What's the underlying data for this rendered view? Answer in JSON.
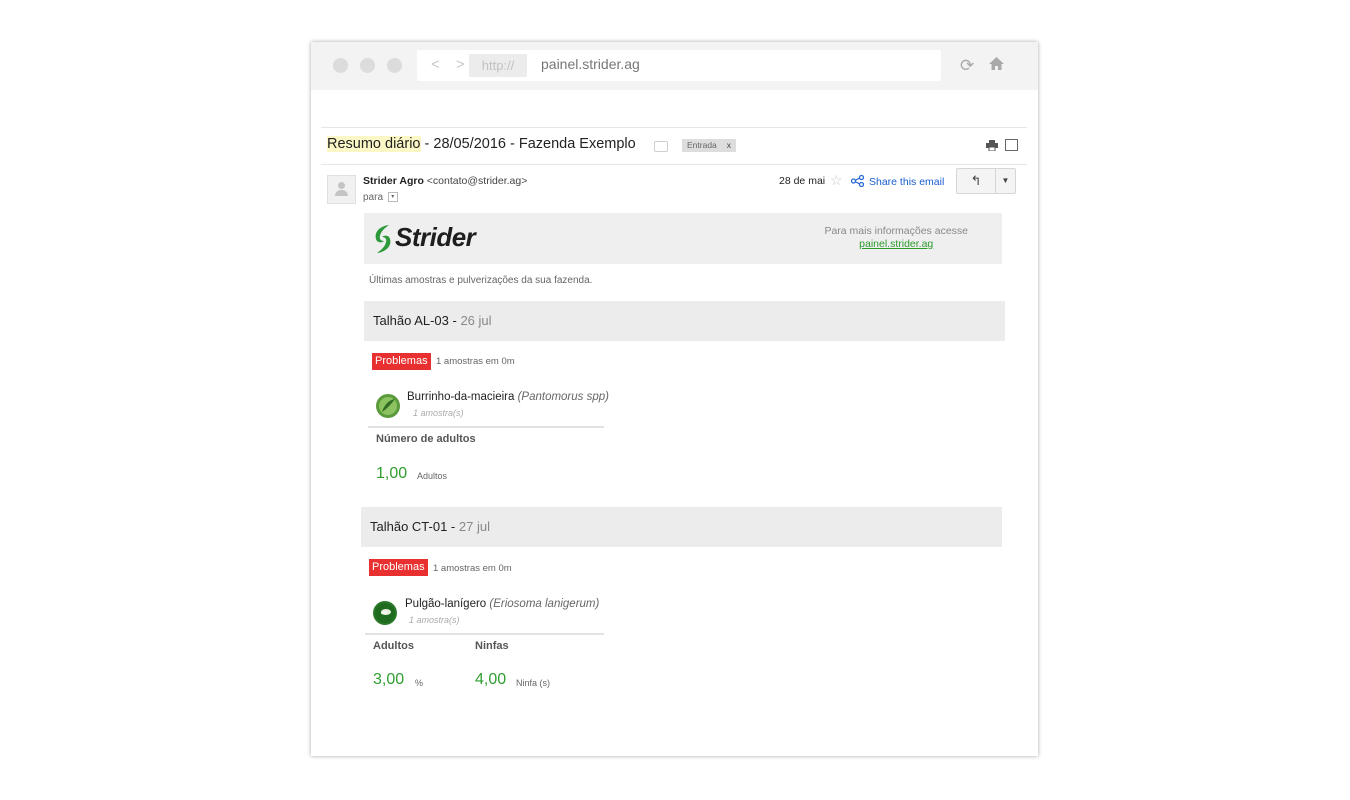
{
  "browser": {
    "nav": "< >",
    "protocol": "http://",
    "url": "painel.strider.ag",
    "reload_icon": "reload-icon",
    "home_icon": "home-icon"
  },
  "email": {
    "subject_highlight": "Resumo diário",
    "subject_rest": " - 28/05/2016 - Fazenda Exemplo",
    "tag": "Entrada",
    "tag_close": "x",
    "sender_name": "Strider Agro",
    "sender_email": "<contato@strider.ag>",
    "to": "para",
    "date": "28 de mai",
    "share": "Share this email"
  },
  "banner": {
    "logo": "Strider",
    "info": "Para mais informações acesse",
    "link": "painel.strider.ag"
  },
  "intro": "Últimas amostras e pulverizações da sua fazenda.",
  "sections": [
    {
      "title": "Talhão AL-03 - ",
      "date": "26 jul",
      "badge": "Problemas",
      "badge_info": "1 amostras em 0m",
      "pest": "Burrinho-da-macieira",
      "pest_sci": "(Pantomorus spp)",
      "pest_count": "1 amostra(s)",
      "metrics": [
        {
          "label": "Número de adultos",
          "value": "1,00",
          "unit": "Adultos"
        }
      ]
    },
    {
      "title": "Talhão CT-01 - ",
      "date": "27 jul",
      "badge": "Problemas",
      "badge_info": "1 amostras em 0m",
      "pest": "Pulgão-lanígero",
      "pest_sci": "(Eriosoma lanigerum)",
      "pest_count": "1 amostra(s)",
      "metrics": [
        {
          "label": "Adultos",
          "value": "3,00",
          "unit": "%"
        },
        {
          "label": "Ninfas",
          "value": "4,00",
          "unit": "Ninfa (s)"
        }
      ]
    }
  ],
  "colors": {
    "accent_green": "#2f9e2f",
    "badge_red": "#e83030",
    "link_blue": "#1a5dd0"
  }
}
